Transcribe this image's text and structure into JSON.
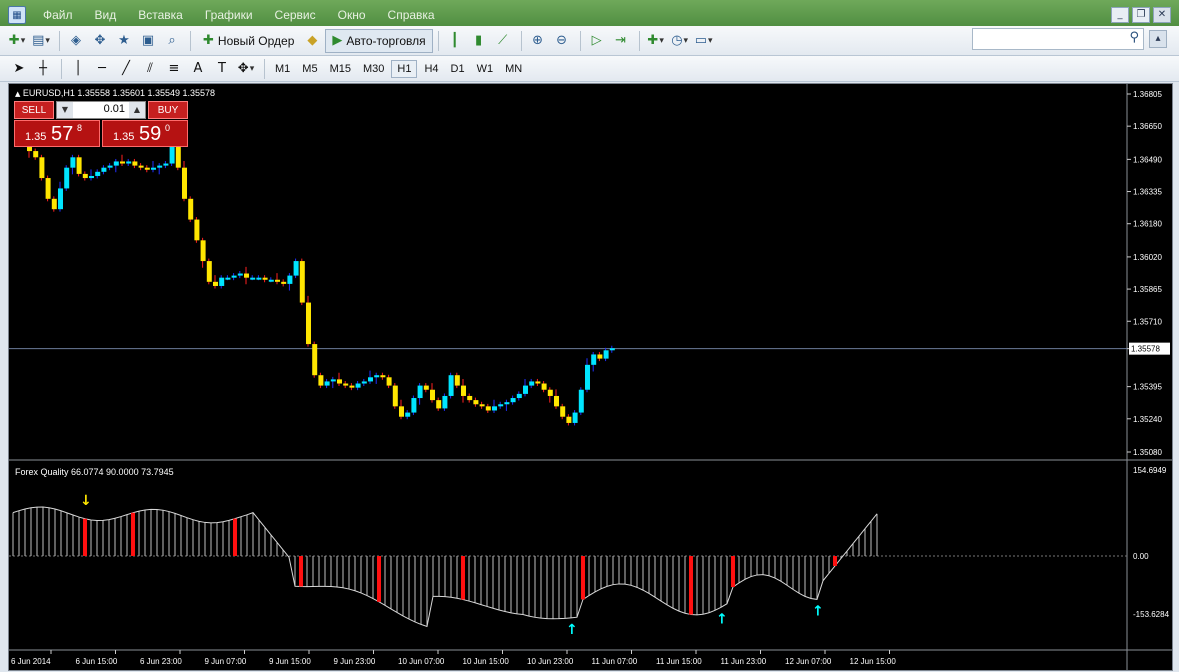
{
  "menu": {
    "items": [
      "Файл",
      "Вид",
      "Вставка",
      "Графики",
      "Сервис",
      "Окно",
      "Справка"
    ]
  },
  "toolbar": {
    "new_order_label": "Новый Ордер",
    "auto_trading_label": "Авто-торговля",
    "search_placeholder": ""
  },
  "timeframes": [
    "M1",
    "M5",
    "M15",
    "M30",
    "H1",
    "H4",
    "D1",
    "W1",
    "MN"
  ],
  "active_timeframe": "H1",
  "chart": {
    "symbol_info": "EURUSD,H1  1.35558 1.35601 1.35549 1.35578",
    "indicator_info": "Forex Quality 66.0774 90.0000 73.7945",
    "current_price": "1.35578",
    "trade_panel": {
      "sell_label": "SELL",
      "buy_label": "BUY",
      "lot": "0.01",
      "sell_prefix": "1.35",
      "sell_big": "57",
      "sell_sup": "8",
      "buy_prefix": "1.35",
      "buy_big": "59",
      "buy_sup": "0"
    }
  },
  "chart_data": {
    "type": "candlestick",
    "price_axis": [
      "1.36805",
      "1.36650",
      "1.36490",
      "1.36335",
      "1.36180",
      "1.36020",
      "1.35865",
      "1.35710",
      "1.35578",
      "1.35395",
      "1.35240",
      "1.35080"
    ],
    "indicator_axis": [
      "154.6949",
      "0.00",
      "-153.6284"
    ],
    "time_axis": [
      "6 Jun 2014",
      "6 Jun 15:00",
      "6 Jun 23:00",
      "9 Jun 07:00",
      "9 Jun 15:00",
      "9 Jun 23:00",
      "10 Jun 07:00",
      "10 Jun 15:00",
      "10 Jun 23:00",
      "11 Jun 07:00",
      "11 Jun 15:00",
      "11 Jun 23:00",
      "12 Jun 07:00",
      "12 Jun 15:00"
    ],
    "colors": {
      "bull": "#00e5ff",
      "bear": "#ffe600",
      "wick_up": "#2030ff",
      "wick_down": "#ff2020",
      "histogram_signal": "#ff1010",
      "arrow_buy": "#00ffff",
      "arrow_sell": "#ffe600"
    },
    "ohlc_close": [
      1.3653,
      1.365,
      1.364,
      1.363,
      1.3625,
      1.3635,
      1.3645,
      1.365,
      1.3642,
      1.364,
      1.3641,
      1.3643,
      1.3645,
      1.3646,
      1.3648,
      1.3647,
      1.3648,
      1.3646,
      1.3645,
      1.3644,
      1.3645,
      1.3646,
      1.3647,
      1.3655,
      1.3645,
      1.363,
      1.362,
      1.361,
      1.36,
      1.359,
      1.3588,
      1.3592,
      1.3592,
      1.3593,
      1.3594,
      1.3592,
      1.3592,
      1.3592,
      1.3591,
      1.3591,
      1.359,
      1.3589,
      1.3593,
      1.36,
      1.358,
      1.356,
      1.3545,
      1.354,
      1.3542,
      1.3543,
      1.3541,
      1.354,
      1.3539,
      1.3541,
      1.3542,
      1.3544,
      1.3545,
      1.3544,
      1.354,
      1.353,
      1.3525,
      1.3527,
      1.3534,
      1.354,
      1.3538,
      1.3533,
      1.3529,
      1.3535,
      1.3545,
      1.354,
      1.3535,
      1.3533,
      1.3531,
      1.353,
      1.3528,
      1.353,
      1.3531,
      1.3532,
      1.3534,
      1.3536,
      1.354,
      1.3542,
      1.3541,
      1.3538,
      1.3535,
      1.353,
      1.3525,
      1.3522,
      1.3527,
      1.3538,
      1.355,
      1.3555,
      1.3553,
      1.3557,
      1.3558
    ],
    "indicator_signals_sell": [
      12
    ],
    "indicator_signals_buy": [
      93,
      118,
      134
    ]
  }
}
